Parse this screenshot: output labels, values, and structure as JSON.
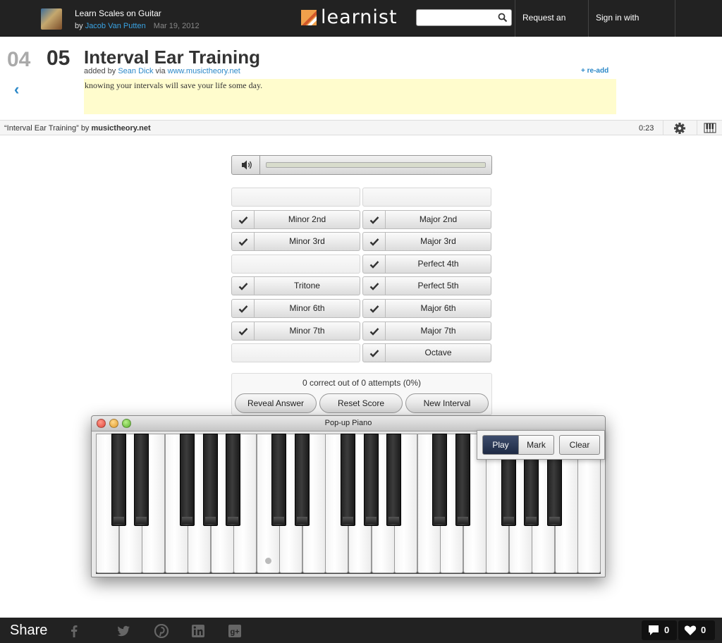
{
  "header": {
    "board_title": "Learn Scales on Guitar",
    "board_by": "by",
    "board_author": "Jacob Van Putten",
    "board_date": "Mar 19, 2012",
    "logo_text": "learnist",
    "search_placeholder": "",
    "request_invite": "Request an Invite",
    "sign_in": "Sign in with Facebook"
  },
  "post": {
    "prev_number": "04",
    "current_number": "05",
    "title": "Interval Ear Training",
    "added_by_prefix": "added by",
    "added_by_user": "Sean Dick",
    "via": "via",
    "source_site": "www.musictheory.net",
    "readd": "+ re-add",
    "note": "knowing your intervals will save your life some day."
  },
  "source_bar": {
    "quoted_title": "“Interval Ear Training” by",
    "site": "musictheory.net",
    "time": "0:23"
  },
  "exercise": {
    "intervals_left": [
      {
        "label": "",
        "checked": false
      },
      {
        "label": "Minor 2nd",
        "checked": true
      },
      {
        "label": "Minor 3rd",
        "checked": true
      },
      {
        "label": "",
        "checked": false
      },
      {
        "label": "Tritone",
        "checked": true
      },
      {
        "label": "Minor 6th",
        "checked": true
      },
      {
        "label": "Minor 7th",
        "checked": true
      },
      {
        "label": "",
        "checked": false
      }
    ],
    "intervals_right": [
      {
        "label": "",
        "checked": false
      },
      {
        "label": "Major 2nd",
        "checked": true
      },
      {
        "label": "Major 3rd",
        "checked": true
      },
      {
        "label": "Perfect 4th",
        "checked": true
      },
      {
        "label": "Perfect 5th",
        "checked": true
      },
      {
        "label": "Major 6th",
        "checked": true
      },
      {
        "label": "Major 7th",
        "checked": true
      },
      {
        "label": "Octave",
        "checked": true
      }
    ],
    "score": "0 correct out of 0 attempts (0%)",
    "reveal_answer": "Reveal Answer",
    "reset_score": "Reset Score",
    "new_interval": "New Interval"
  },
  "piano": {
    "window_title": "Pop-up Piano",
    "play": "Play",
    "mark": "Mark",
    "clear": "Clear",
    "white_key_count": 22
  },
  "share": {
    "label": "Share",
    "comments": "0",
    "likes": "0"
  },
  "colors": {
    "topbar": "#222222",
    "link": "#2b88c8",
    "note_bg": "#fffccd",
    "play_active": "#2a3654"
  }
}
